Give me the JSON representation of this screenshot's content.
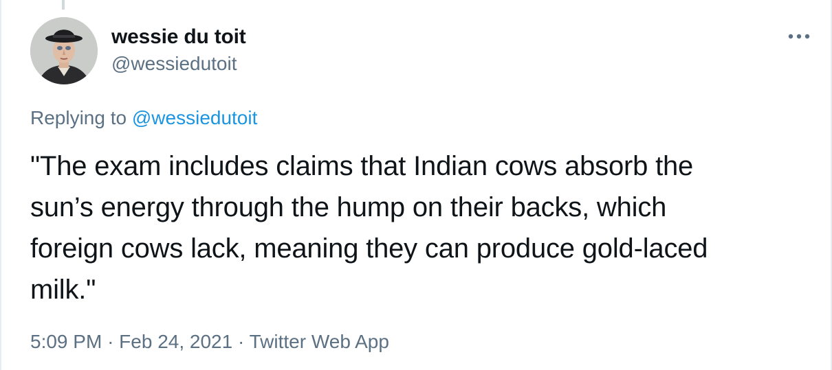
{
  "author": {
    "display_name": "wessie du toit",
    "handle": "@wessiedutoit",
    "avatar_icon": "avatar-portrait"
  },
  "reply_context": {
    "prefix": "Replying to",
    "mention": "@wessiedutoit"
  },
  "tweet": {
    "lines": [
      "\"The exam includes claims that Indian cows absorb the",
      "sun’s energy through the hump on their backs, which",
      "foreign cows lack, meaning they can produce gold-laced",
      "milk.\""
    ]
  },
  "meta": {
    "time": "5:09 PM",
    "separator": "·",
    "date": "Feb 24, 2021",
    "source": "Twitter Web App"
  },
  "icons": {
    "more": "more-horizontal-icon"
  },
  "colors": {
    "primary_text": "#0f1419",
    "secondary_text": "#5b7083",
    "link": "#1b95e0",
    "border": "#e6ecf0"
  }
}
